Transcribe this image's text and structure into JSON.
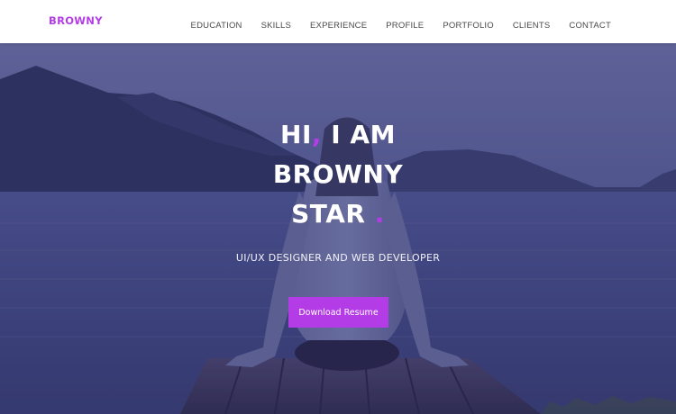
{
  "header": {
    "brand": "BROWNY",
    "nav": [
      {
        "label": "EDUCATION"
      },
      {
        "label": "SKILLS"
      },
      {
        "label": "EXPERIENCE"
      },
      {
        "label": "PROFILE"
      },
      {
        "label": "PORTFOLIO"
      },
      {
        "label": "CLIENTS"
      },
      {
        "label": "CONTACT"
      }
    ]
  },
  "hero": {
    "greeting": "HI",
    "comma": ",",
    "intro": " I AM",
    "name_first": "BROWNY",
    "name_last": "STAR",
    "dot": ".",
    "subtitle": "UI/UX DESIGNER AND WEB DEVELOPER",
    "cta_label": "Download Resume"
  },
  "colors": {
    "accent": "#b43ce6",
    "nav_text": "#4a4a4a",
    "header_bg": "#ffffff",
    "hero_tint": "#34327a"
  }
}
